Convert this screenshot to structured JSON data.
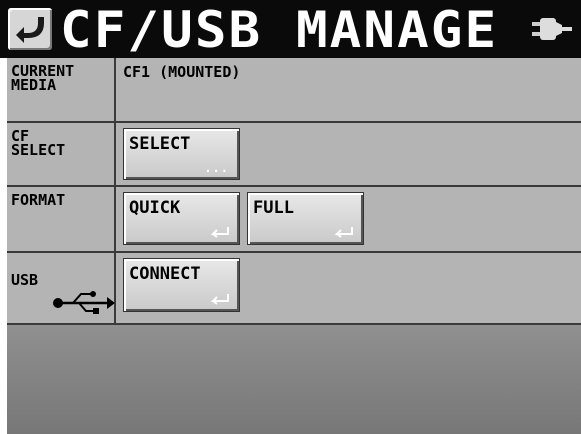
{
  "header": {
    "title": "CF/USB MANAGE",
    "back_icon": "return-arrow-icon",
    "status_icon": "usb-plug-icon"
  },
  "rows": {
    "current_media": {
      "label": "CURRENT\nMEDIA",
      "value": "CF1 (MOUNTED)"
    },
    "cf_select": {
      "label": "CF\nSELECT",
      "button_label": "SELECT",
      "button_mark": "..."
    },
    "format": {
      "label": "FORMAT",
      "buttons": [
        "QUICK",
        "FULL"
      ]
    },
    "usb": {
      "label": "USB",
      "icon": "usb-symbol-icon",
      "button_label": "CONNECT"
    }
  },
  "colors": {
    "title_bar": "#0a0a0a",
    "panel": "#b4b4b4",
    "button": "#d4d4d4"
  }
}
